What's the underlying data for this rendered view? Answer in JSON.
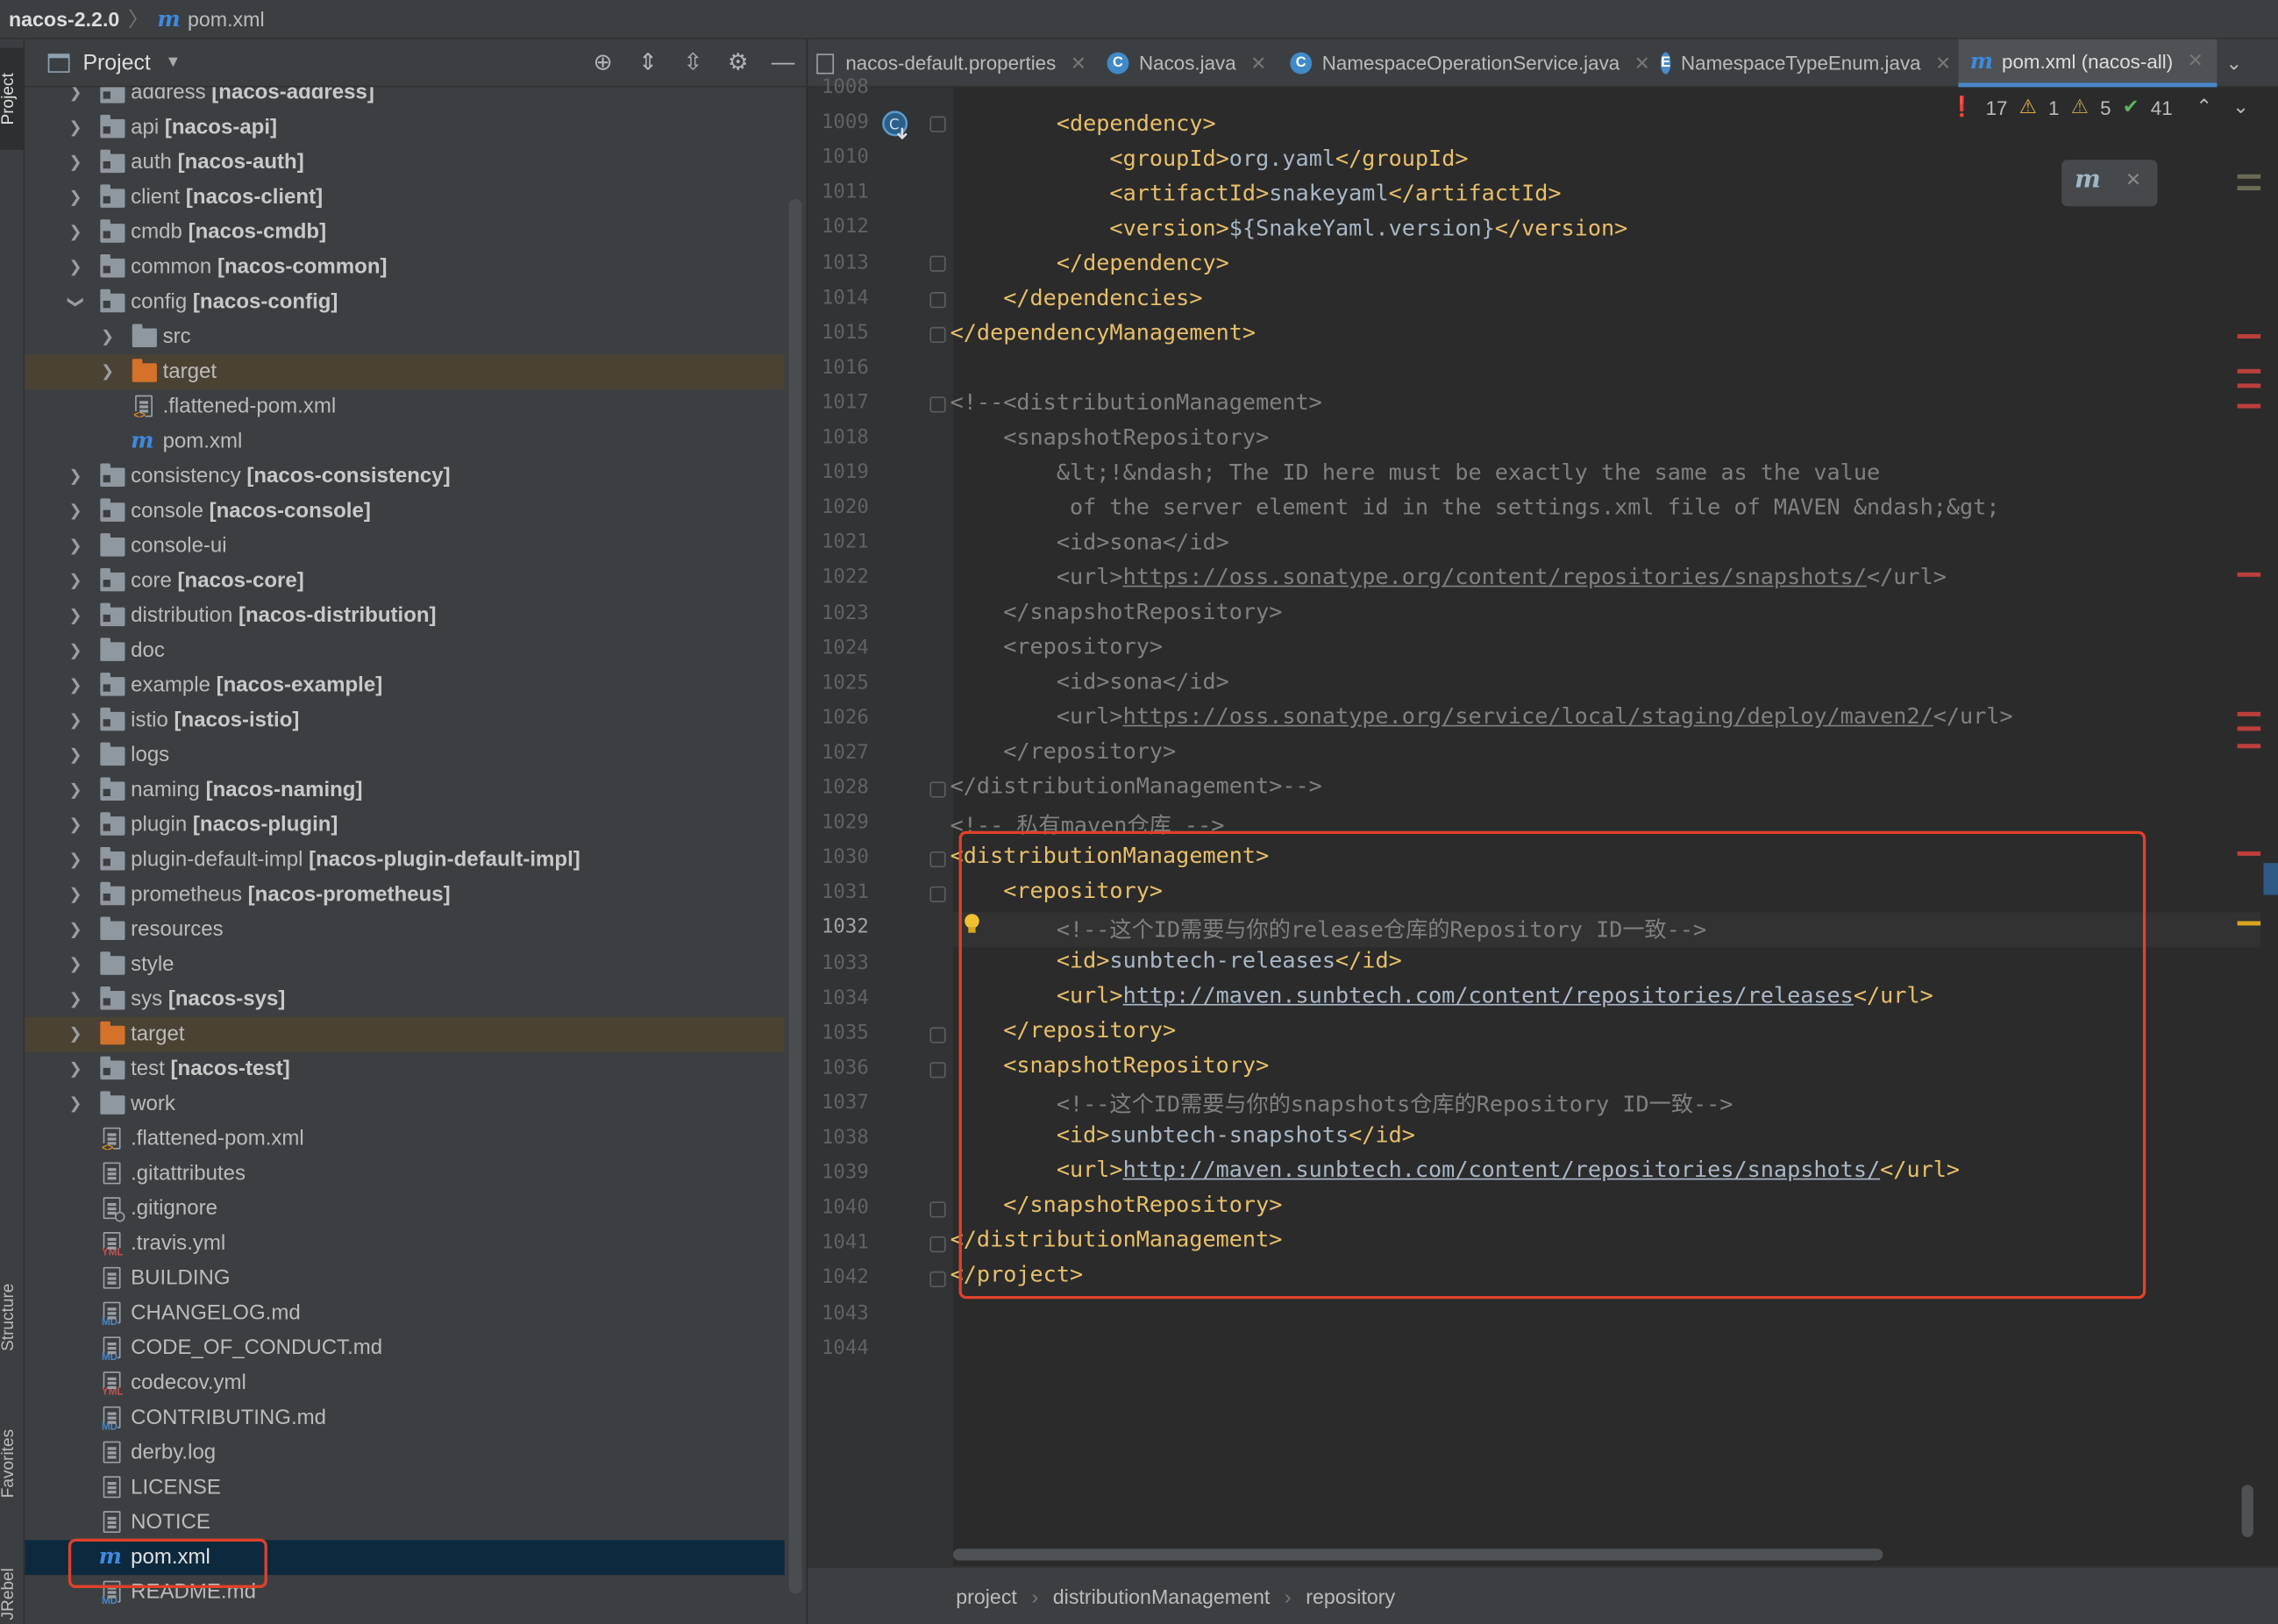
{
  "titlebar": {
    "project": "nacos-2.2.0",
    "file": "pom.xml"
  },
  "side_labels": {
    "project": "Project",
    "structure": "Structure",
    "favorites": "Favorites",
    "jrebel": "JRebel"
  },
  "project_panel": {
    "title": "Project"
  },
  "tree": [
    {
      "name": "address",
      "module": "[nacos-address]"
    },
    {
      "name": "api",
      "module": "[nacos-api]"
    },
    {
      "name": "auth",
      "module": "[nacos-auth]"
    },
    {
      "name": "client",
      "module": "[nacos-client]"
    },
    {
      "name": "cmdb",
      "module": "[nacos-cmdb]"
    },
    {
      "name": "common",
      "module": "[nacos-common]"
    },
    {
      "name": "config",
      "module": "[nacos-config]"
    },
    {
      "name": "src",
      "module": ""
    },
    {
      "name": "target",
      "module": ""
    },
    {
      "name": ".flattened-pom.xml",
      "module": ""
    },
    {
      "name": "pom.xml",
      "module": ""
    },
    {
      "name": "consistency",
      "module": "[nacos-consistency]"
    },
    {
      "name": "console",
      "module": "[nacos-console]"
    },
    {
      "name": "console-ui",
      "module": ""
    },
    {
      "name": "core",
      "module": "[nacos-core]"
    },
    {
      "name": "distribution",
      "module": "[nacos-distribution]"
    },
    {
      "name": "doc",
      "module": ""
    },
    {
      "name": "example",
      "module": "[nacos-example]"
    },
    {
      "name": "istio",
      "module": "[nacos-istio]"
    },
    {
      "name": "logs",
      "module": ""
    },
    {
      "name": "naming",
      "module": "[nacos-naming]"
    },
    {
      "name": "plugin",
      "module": "[nacos-plugin]"
    },
    {
      "name": "plugin-default-impl",
      "module": "[nacos-plugin-default-impl]"
    },
    {
      "name": "prometheus",
      "module": "[nacos-prometheus]"
    },
    {
      "name": "resources",
      "module": ""
    },
    {
      "name": "style",
      "module": ""
    },
    {
      "name": "sys",
      "module": "[nacos-sys]"
    },
    {
      "name": "target",
      "module": ""
    },
    {
      "name": "test",
      "module": "[nacos-test]"
    },
    {
      "name": "work",
      "module": ""
    },
    {
      "name": ".flattened-pom.xml",
      "module": ""
    },
    {
      "name": ".gitattributes",
      "module": ""
    },
    {
      "name": ".gitignore",
      "module": ""
    },
    {
      "name": ".travis.yml",
      "module": ""
    },
    {
      "name": "BUILDING",
      "module": ""
    },
    {
      "name": "CHANGELOG.md",
      "module": ""
    },
    {
      "name": "CODE_OF_CONDUCT.md",
      "module": ""
    },
    {
      "name": "codecov.yml",
      "module": ""
    },
    {
      "name": "CONTRIBUTING.md",
      "module": ""
    },
    {
      "name": "derby.log",
      "module": ""
    },
    {
      "name": "LICENSE",
      "module": ""
    },
    {
      "name": "NOTICE",
      "module": ""
    },
    {
      "name": "pom.xml",
      "module": ""
    },
    {
      "name": "README.md",
      "module": ""
    }
  ],
  "tabs": [
    {
      "label": "nacos-default.properties"
    },
    {
      "label": "Nacos.java"
    },
    {
      "label": "NamespaceOperationService.java"
    },
    {
      "label": "NamespaceTypeEnum.java"
    },
    {
      "label": "pom.xml (nacos-all)"
    }
  ],
  "inspections": {
    "errors": "17",
    "warnings": "1",
    "weak_warnings": "5",
    "ok": "41"
  },
  "line_numbers": [
    "1008",
    "1009",
    "1010",
    "1011",
    "1012",
    "1013",
    "1014",
    "1015",
    "1016",
    "1017",
    "1018",
    "1019",
    "1020",
    "1021",
    "1022",
    "1023",
    "1024",
    "1025",
    "1026",
    "1027",
    "1028",
    "1029",
    "1030",
    "1031",
    "1032",
    "1033",
    "1034",
    "1035",
    "1036",
    "1037",
    "1038",
    "1039",
    "1040",
    "1041",
    "1042",
    "1043",
    "1044"
  ],
  "code": {
    "l1009": "<dependency>",
    "l1010_open": "<groupId>",
    "l1010_val": "org.yaml",
    "l1010_close": "</groupId>",
    "l1011_open": "<artifactId>",
    "l1011_val": "snakeyaml",
    "l1011_close": "</artifactId>",
    "l1012_open": "<version>",
    "l1012_val": "${SnakeYaml.version}",
    "l1012_close": "</version>",
    "l1013": "</dependency>",
    "l1014": "</dependencies>",
    "l1015": "</dependencyManagement>",
    "l1017": "<!--<distributionManagement>",
    "l1018": "<snapshotRepository>",
    "l1019": "&lt;!&ndash; The ID here must be exactly the same as the value",
    "l1020": " of the server element id in the settings.xml file of MAVEN &ndash;&gt;",
    "l1021": "<id>sona</id>",
    "l1022_open": "<url>",
    "l1022_url": "https://oss.sonatype.org/content/repositories/snapshots/",
    "l1022_close": "</url>",
    "l1023": "</snapshotRepository>",
    "l1024": "<repository>",
    "l1025": "<id>sona</id>",
    "l1026_open": "<url>",
    "l1026_url": "https://oss.sonatype.org/service/local/staging/deploy/maven2/",
    "l1026_close": "</url>",
    "l1027": "</repository>",
    "l1028": "</distributionManagement>-->",
    "l1029": "<!-- 私有maven仓库 -->",
    "l1030": "<distributionManagement>",
    "l1031": "<repository>",
    "l1032": "<!--这个ID需要与你的release仓库的Repository ID一致-->",
    "l1033_open": "<id>",
    "l1033_val": "sunbtech-releases",
    "l1033_close": "</id>",
    "l1034_open": "<url>",
    "l1034_url": "http://maven.sunbtech.com/content/repositories/releases",
    "l1034_close": "</url>",
    "l1035": "</repository>",
    "l1036": "<snapshotRepository>",
    "l1037": "<!--这个ID需要与你的snapshots仓库的Repository ID一致-->",
    "l1038_open": "<id>",
    "l1038_val": "sunbtech-snapshots",
    "l1038_close": "</id>",
    "l1039_open": "<url>",
    "l1039_url": "http://maven.sunbtech.com/content/repositories/snapshots/",
    "l1039_close": "</url>",
    "l1040": "</snapshotRepository>",
    "l1041": "</distributionManagement>",
    "l1042": "</project>"
  },
  "breadcrumb": [
    "project",
    "distributionManagement",
    "repository"
  ],
  "colors": {
    "tag": "#e8bf6a",
    "comment": "#808080",
    "text": "#a9b7c6",
    "highlight_box": "#e0412b",
    "selection": "#0d293e"
  }
}
